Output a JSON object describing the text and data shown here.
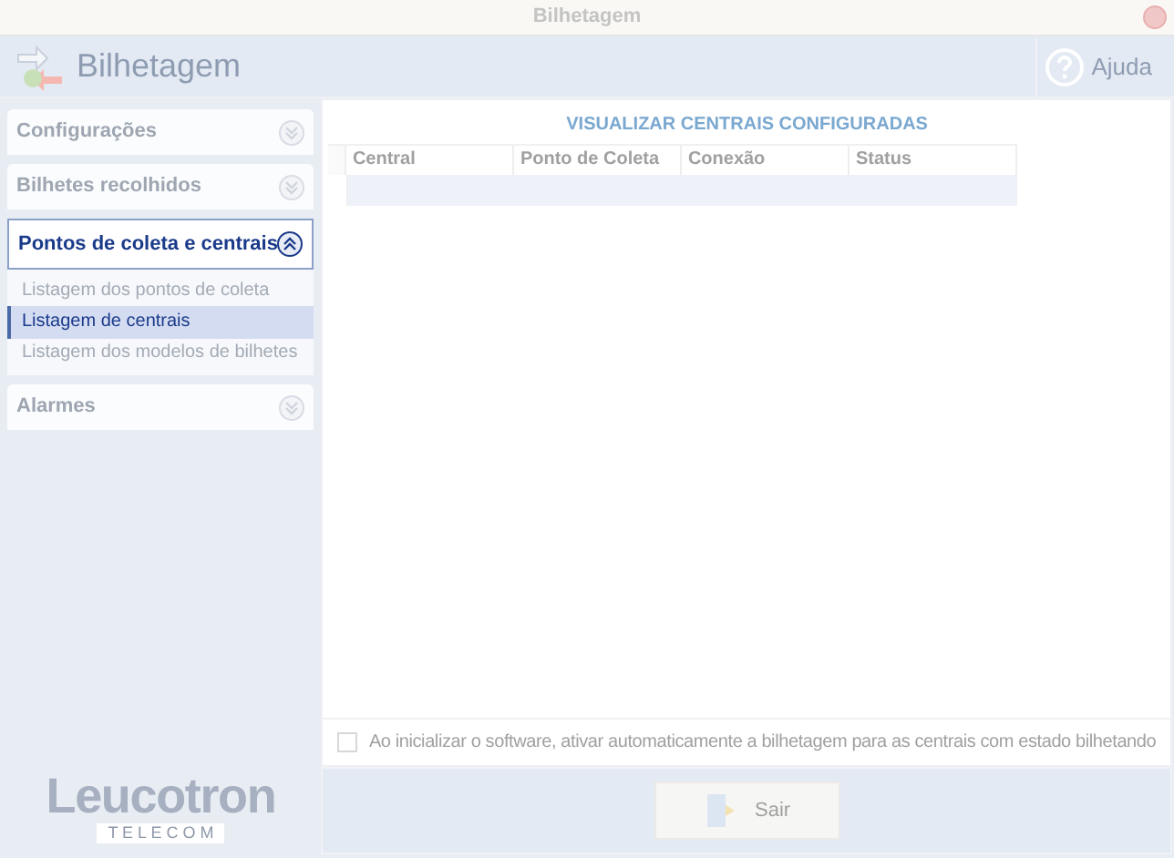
{
  "window": {
    "title": "Bilhetagem"
  },
  "header": {
    "title": "Bilhetagem",
    "help": "Ajuda"
  },
  "sidebar": {
    "sections": [
      {
        "label": "Configurações",
        "expanded": false
      },
      {
        "label": "Bilhetes recolhidos",
        "expanded": false
      },
      {
        "label": "Pontos de coleta e centrais",
        "expanded": true,
        "items": [
          {
            "label": "Listagem dos pontos de coleta",
            "selected": false
          },
          {
            "label": "Listagem de centrais",
            "selected": true
          },
          {
            "label": "Listagem dos modelos de bilhetes",
            "selected": false
          }
        ]
      },
      {
        "label": "Alarmes",
        "expanded": false
      }
    ],
    "logo": {
      "name": "Leucotron",
      "tagline": "T E L E C O M"
    }
  },
  "content": {
    "title": "VISUALIZAR CENTRAIS CONFIGURADAS",
    "table": {
      "columns": [
        "Central",
        "Ponto de Coleta",
        "Conexão",
        "Status"
      ]
    },
    "auto_start": {
      "label": "Ao inicializar o software, ativar automaticamente a bilhetagem para as centrais com estado bilhetando",
      "checked": false
    },
    "exit_button": "Sair"
  }
}
